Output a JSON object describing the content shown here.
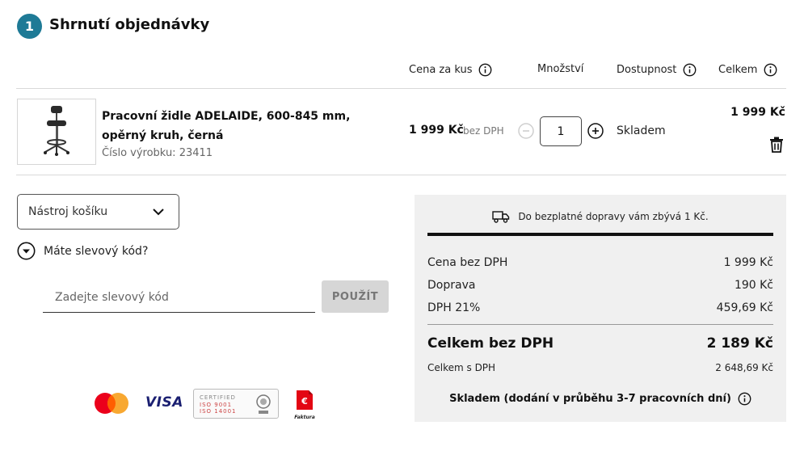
{
  "header": {
    "step": "1",
    "title": "Shrnutí objednávky"
  },
  "columns": {
    "unit_price": "Cena za kus",
    "quantity": "Množství",
    "availability": "Dostupnost",
    "total": "Celkem"
  },
  "product": {
    "name": "Pracovní židle ADELAIDE, 600-845 mm, opěrný kruh, černá",
    "code": "Číslo výrobku: 23411",
    "unit_price": "1 999 Kč",
    "vat_note": "bez DPH",
    "quantity": "1",
    "availability": "Skladem",
    "line_total": "1 999 Kč"
  },
  "cart_tool": {
    "label": "Nástroj košíku"
  },
  "discount": {
    "toggle_label": "Máte slevový kód?",
    "placeholder": "Zadejte slevový kód",
    "apply_label": "POUŽÍT"
  },
  "payments": {
    "visa": "VISA",
    "iso_line1": "CERTIFIED",
    "iso_line2": "ISO 9001",
    "iso_line3": "ISO 14001",
    "invoice": "Faktura"
  },
  "summary": {
    "shipping_note": "Do bezplatné dopravy vám zbývá 1 Kč.",
    "rows": [
      {
        "label": "Cena bez DPH",
        "value": "1 999 Kč"
      },
      {
        "label": "Doprava",
        "value": "190 Kč"
      },
      {
        "label": "DPH 21%",
        "value": "459,69 Kč"
      }
    ],
    "total_ex_vat": {
      "label": "Celkem bez DPH",
      "value": "2 189 Kč"
    },
    "total_inc_vat": {
      "label": "Celkem s DPH",
      "value": "2 648,69 Kč"
    },
    "stock_note": "Skladem (dodání v průběhu 3-7 pracovních dní)"
  },
  "colors": {
    "accent": "#1e7a96",
    "panel": "#f0f0f0",
    "mastercard_red": "#eb001b",
    "mastercard_orange": "#f79e1b",
    "invoice_red": "#e30613"
  },
  "icons": [
    "info-icon",
    "minus-circle-icon",
    "plus-circle-icon",
    "trash-icon",
    "chevron-down-icon",
    "chevron-down-circle-icon",
    "truck-icon"
  ]
}
